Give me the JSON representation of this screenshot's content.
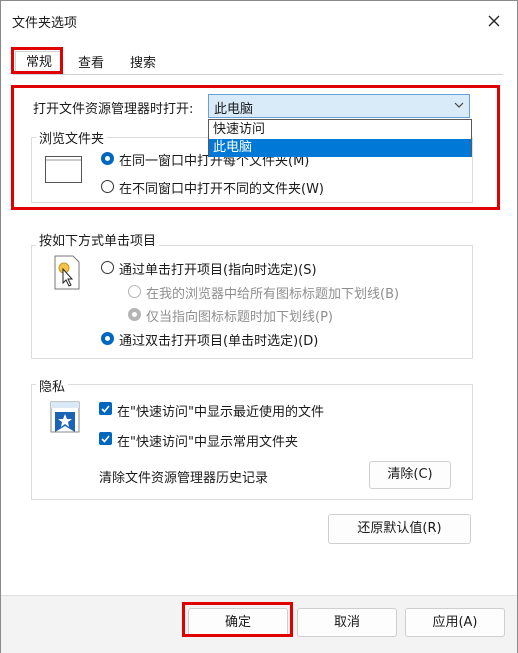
{
  "window": {
    "title": "文件夹选项"
  },
  "tabs": [
    {
      "label": "常规"
    },
    {
      "label": "查看"
    },
    {
      "label": "搜索"
    }
  ],
  "open_explorer": {
    "label": "打开文件资源管理器时打开:",
    "selected": "此电脑",
    "options": [
      "快速访问",
      "此电脑"
    ]
  },
  "browse": {
    "group_title": "浏览文件夹",
    "option_same": "在同一窗口中打开每个文件夹(M)",
    "option_different": "在不同窗口中打开不同的文件夹(W)"
  },
  "click": {
    "group_title": "按如下方式单击项目",
    "single_click": "通过单击打开项目(指向时选定)(S)",
    "underline_all": "在我的浏览器中给所有图标标题加下划线(B)",
    "underline_hover": "仅当指向图标标题时加下划线(P)",
    "double_click": "通过双击打开项目(单击时选定)(D)"
  },
  "privacy": {
    "group_title": "隐私",
    "recent_files": "在\"快速访问\"中显示最近使用的文件",
    "frequent_folders": "在\"快速访问\"中显示常用文件夹",
    "clear_label": "清除文件资源管理器历史记录",
    "clear_button": "清除(C)"
  },
  "restore_defaults": "还原默认值(R)",
  "footer": {
    "ok": "确定",
    "cancel": "取消",
    "apply": "应用(A)"
  },
  "colors": {
    "highlight": "#e00000",
    "accent": "#0067c0",
    "selection": "#0078d7"
  }
}
